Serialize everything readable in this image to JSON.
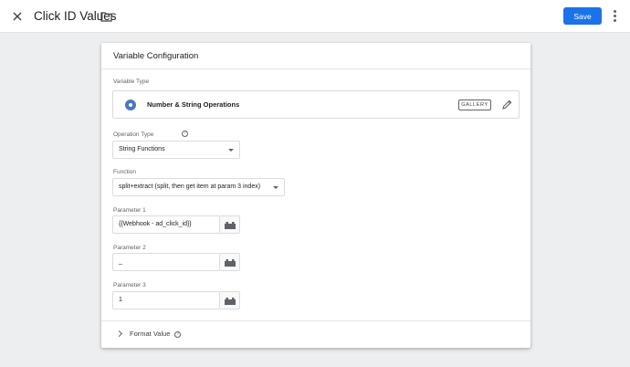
{
  "header": {
    "title": "Click ID Values",
    "save_label": "Save",
    "icons": {
      "close": "close-icon",
      "folder": "folder-icon",
      "more": "more-vert-icon"
    }
  },
  "card": {
    "title": "Variable Configuration",
    "variable_type": {
      "label": "Variable Type",
      "name": "Number & String Operations",
      "gallery_label": "GALLERY"
    },
    "operation_type": {
      "label": "Operation Type",
      "value": "String Functions"
    },
    "function": {
      "label": "Function",
      "value": "split+extract (split, then get item at param 3 index)"
    },
    "params": [
      {
        "label": "Parameter 1",
        "value": "{{Webhook - ad_click_id}}"
      },
      {
        "label": "Parameter 2",
        "value": "_"
      },
      {
        "label": "Parameter 3",
        "value": "1"
      }
    ],
    "format_value_label": "Format Value"
  },
  "colors": {
    "accent": "#1a73e8",
    "background": "#eceef0",
    "icon_blue": "#4a76c4"
  }
}
